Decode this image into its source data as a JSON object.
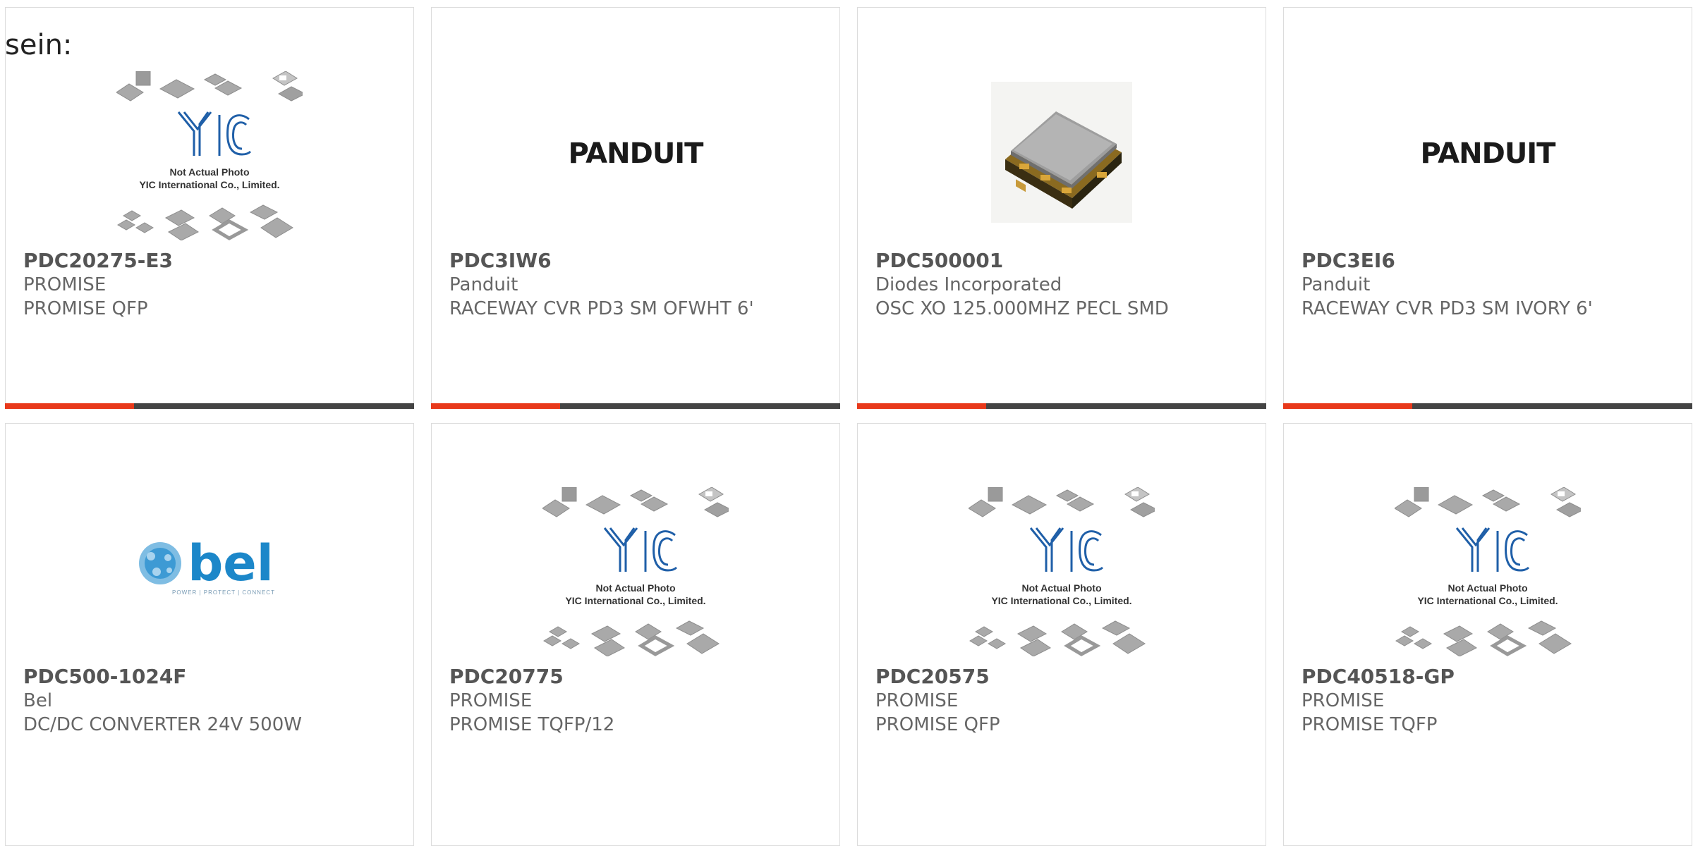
{
  "heading": "sein:",
  "products": [
    {
      "part_number": "PDC20275-E3",
      "manufacturer": "PROMISE",
      "description": "PROMISE QFP",
      "image": "yic-placeholder",
      "placeholder_caption": "Not Actual Photo",
      "placeholder_company": "YIC International Co., Limited.",
      "placeholder_logo": "YIC"
    },
    {
      "part_number": "PDC3IW6",
      "manufacturer": "Panduit",
      "description": "RACEWAY CVR PD3 SM OFWHT 6'",
      "image": "panduit-logo",
      "logo_text": "PANDUIT"
    },
    {
      "part_number": "PDC500001",
      "manufacturer": "Diodes Incorporated",
      "description": "OSC XO 125.000MHZ PECL SMD",
      "image": "oscillator-photo"
    },
    {
      "part_number": "PDC3EI6",
      "manufacturer": "Panduit",
      "description": "RACEWAY CVR PD3 SM IVORY 6'",
      "image": "panduit-logo",
      "logo_text": "PANDUIT"
    },
    {
      "part_number": "PDC500-1024F",
      "manufacturer": "Bel",
      "description": "DC/DC CONVERTER 24V 500W",
      "image": "bel-logo",
      "logo_text": "bel",
      "logo_tagline": "POWER | PROTECT | CONNECT"
    },
    {
      "part_number": "PDC20775",
      "manufacturer": "PROMISE",
      "description": "PROMISE TQFP/12",
      "image": "yic-placeholder",
      "placeholder_caption": "Not Actual Photo",
      "placeholder_company": "YIC International Co., Limited.",
      "placeholder_logo": "YIC"
    },
    {
      "part_number": "PDC20575",
      "manufacturer": "PROMISE",
      "description": "PROMISE QFP",
      "image": "yic-placeholder",
      "placeholder_caption": "Not Actual Photo",
      "placeholder_company": "YIC International Co., Limited.",
      "placeholder_logo": "YIC"
    },
    {
      "part_number": "PDC40518-GP",
      "manufacturer": "PROMISE",
      "description": "PROMISE TQFP",
      "image": "yic-placeholder",
      "placeholder_caption": "Not Actual Photo",
      "placeholder_company": "YIC International Co., Limited.",
      "placeholder_logo": "YIC"
    }
  ],
  "colors": {
    "accent": "#e8391b",
    "bar_dark": "#444444",
    "yic_blue": "#1f5fa8",
    "bel_blue": "#1c87c9"
  }
}
